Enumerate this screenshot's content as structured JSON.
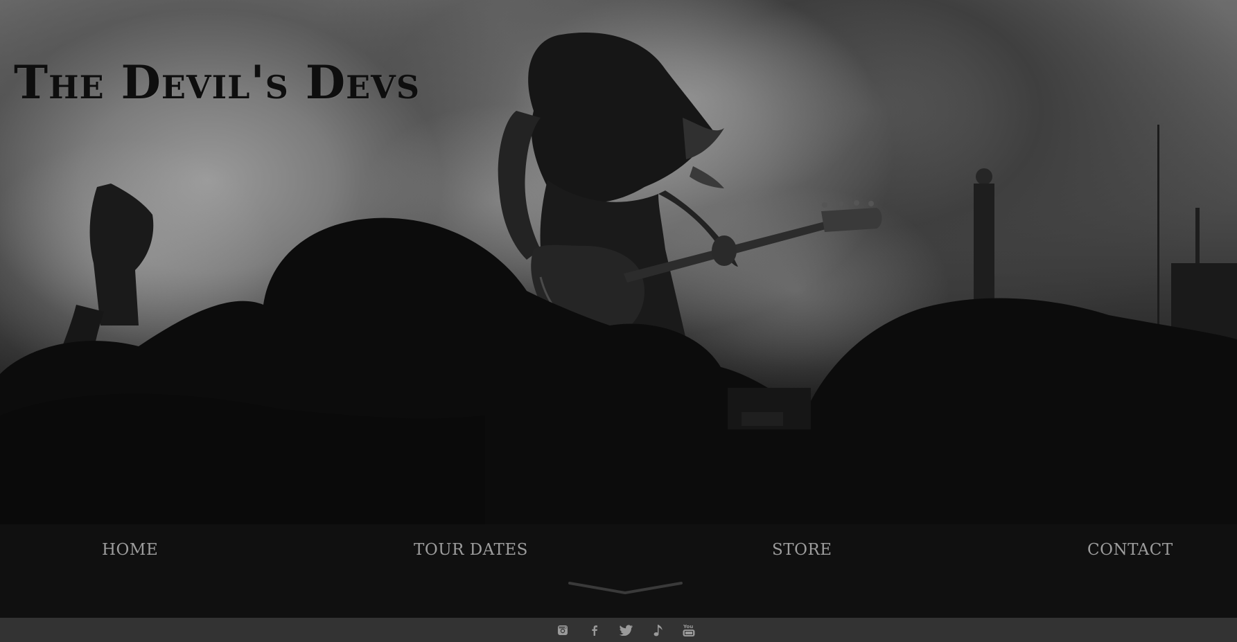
{
  "hero": {
    "band_name": "The Devil's Devs"
  },
  "nav": {
    "items": [
      {
        "label": "HOME"
      },
      {
        "label": "TOUR DATES"
      },
      {
        "label": "STORE"
      },
      {
        "label": "CONTACT"
      }
    ]
  },
  "footer": {
    "social_icons": [
      "instagram-icon",
      "facebook-icon",
      "twitter-icon",
      "music-note-icon",
      "youtube-icon"
    ],
    "youtube_glyph_text": "You Tube"
  },
  "colors": {
    "nav_background": "#101010",
    "nav_text": "#9d9d9d",
    "footer_background": "#333333",
    "icon_color": "#9a9a9a"
  }
}
